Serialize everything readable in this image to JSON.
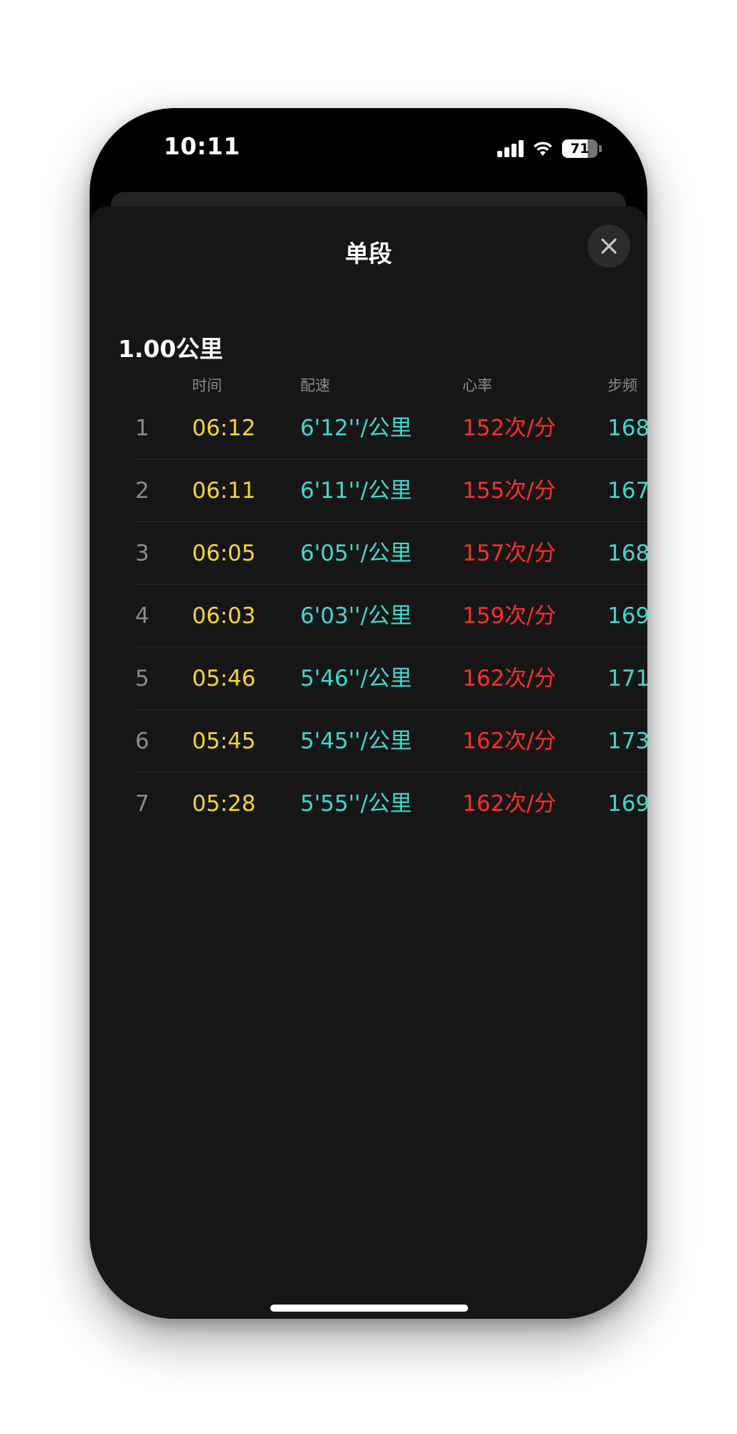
{
  "status_bar": {
    "time": "10:11",
    "battery": "71",
    "battery_level": 0.71
  },
  "sheet": {
    "title": "单段",
    "close_icon": "close-icon"
  },
  "section": {
    "title": "1.00公里"
  },
  "columns": {
    "time": "时间",
    "pace": "配速",
    "heart_rate": "心率",
    "cadence": "步频"
  },
  "rows": [
    {
      "index": "1",
      "time": "06:12",
      "pace": "6'12''/公里",
      "heart_rate": "152次/分",
      "cadence": "168"
    },
    {
      "index": "2",
      "time": "06:11",
      "pace": "6'11''/公里",
      "heart_rate": "155次/分",
      "cadence": "167"
    },
    {
      "index": "3",
      "time": "06:05",
      "pace": "6'05''/公里",
      "heart_rate": "157次/分",
      "cadence": "168"
    },
    {
      "index": "4",
      "time": "06:03",
      "pace": "6'03''/公里",
      "heart_rate": "159次/分",
      "cadence": "169"
    },
    {
      "index": "5",
      "time": "05:46",
      "pace": "5'46''/公里",
      "heart_rate": "162次/分",
      "cadence": "171"
    },
    {
      "index": "6",
      "time": "05:45",
      "pace": "5'45''/公里",
      "heart_rate": "162次/分",
      "cadence": "173"
    },
    {
      "index": "7",
      "time": "05:28",
      "pace": "5'55''/公里",
      "heart_rate": "162次/分",
      "cadence": "169"
    }
  ],
  "colors": {
    "time": "#f5d531",
    "pace": "#3fd8d0",
    "heart_rate": "#ff2d2d",
    "cadence": "#3fd8d0"
  }
}
